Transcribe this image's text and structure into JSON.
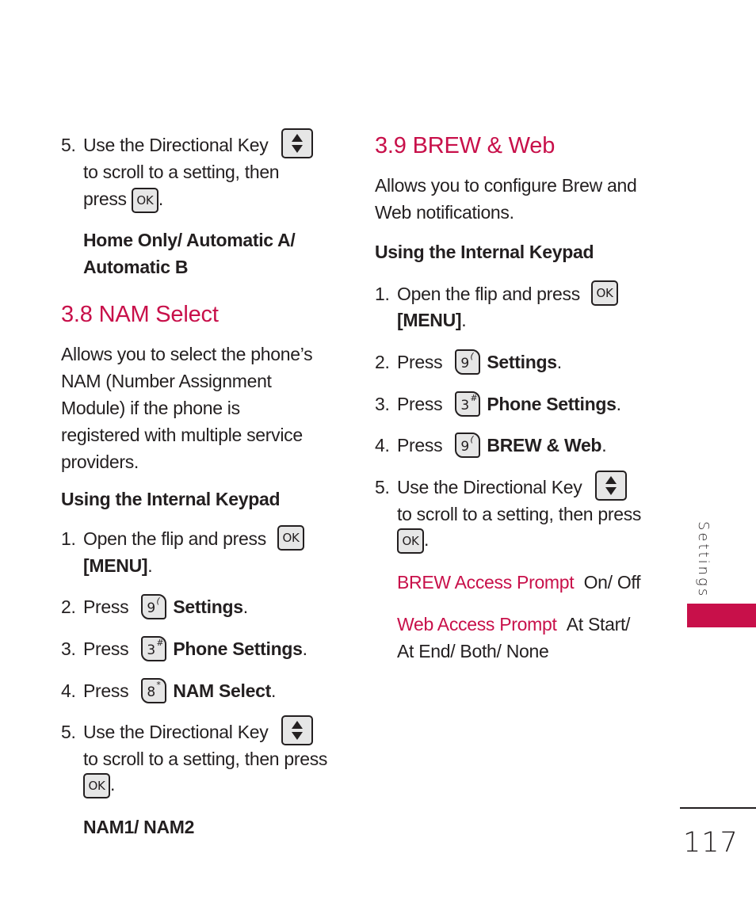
{
  "left_column": {
    "intro_step": {
      "number": "5.",
      "line1": "Use the Directional Key",
      "line2": "to scroll to a setting, then",
      "line3_pre": "press",
      "line3_post": ".",
      "options": [
        "Home Only/ Automatic A/",
        "Automatic B"
      ]
    },
    "section": {
      "heading": "3.8 NAM Select",
      "description": [
        "Allows you to select the phone’s",
        "NAM (Number Assignment",
        "Module) if the phone is",
        "registered with multiple service",
        "providers."
      ],
      "subheading": "Using the Internal Keypad",
      "steps": [
        {
          "number": "1.",
          "text": "Open the flip and press",
          "bold_line": "[MENU]",
          "suffix": "."
        },
        {
          "number": "2.",
          "text": "Press",
          "key_digit": "9",
          "key_symbol": "(",
          "target": "Settings",
          "suffix": "."
        },
        {
          "number": "3.",
          "text": "Press",
          "key_digit": "3",
          "key_symbol": "#",
          "target": "Phone Settings",
          "suffix": "."
        },
        {
          "number": "4.",
          "text": "Press",
          "key_digit": "8",
          "key_symbol": "*",
          "target": "NAM Select",
          "suffix": "."
        },
        {
          "number": "5.",
          "line1": "Use the Directional Key",
          "line2": "to scroll to a setting, then press",
          "suffix": "."
        }
      ],
      "options": "NAM1/ NAM2"
    }
  },
  "right_column": {
    "section": {
      "heading": "3.9 BREW & Web",
      "description": [
        "Allows you to configure Brew and",
        "Web notifications."
      ],
      "subheading": "Using the Internal Keypad",
      "steps": [
        {
          "number": "1.",
          "text": "Open the flip and press",
          "bold_line": "[MENU]",
          "suffix": "."
        },
        {
          "number": "2.",
          "text": "Press",
          "key_digit": "9",
          "key_symbol": "(",
          "target": "Settings",
          "suffix": "."
        },
        {
          "number": "3.",
          "text": "Press",
          "key_digit": "3",
          "key_symbol": "#",
          "target": "Phone Settings",
          "suffix": "."
        },
        {
          "number": "4.",
          "text": "Press",
          "key_digit": "9",
          "key_symbol": "(",
          "target": "BREW & Web",
          "suffix": "."
        },
        {
          "number": "5.",
          "line1": "Use the Directional Key",
          "line2": "to scroll to a setting, then press",
          "suffix": "."
        }
      ],
      "settings": [
        {
          "name": "BREW Access Prompt",
          "values": "On/ Off"
        },
        {
          "name": "Web Access Prompt",
          "values": "At Start/",
          "values_cont": "At End/ Both/ None"
        }
      ]
    }
  },
  "keys": {
    "ok_label": "OK",
    "directional_icon": "up-down-arrow-key",
    "ok_icon": "ok-key"
  },
  "sidebar": {
    "section_label": "Settings",
    "accent_color": "#c8104a"
  },
  "footer": {
    "page_number": "117"
  }
}
